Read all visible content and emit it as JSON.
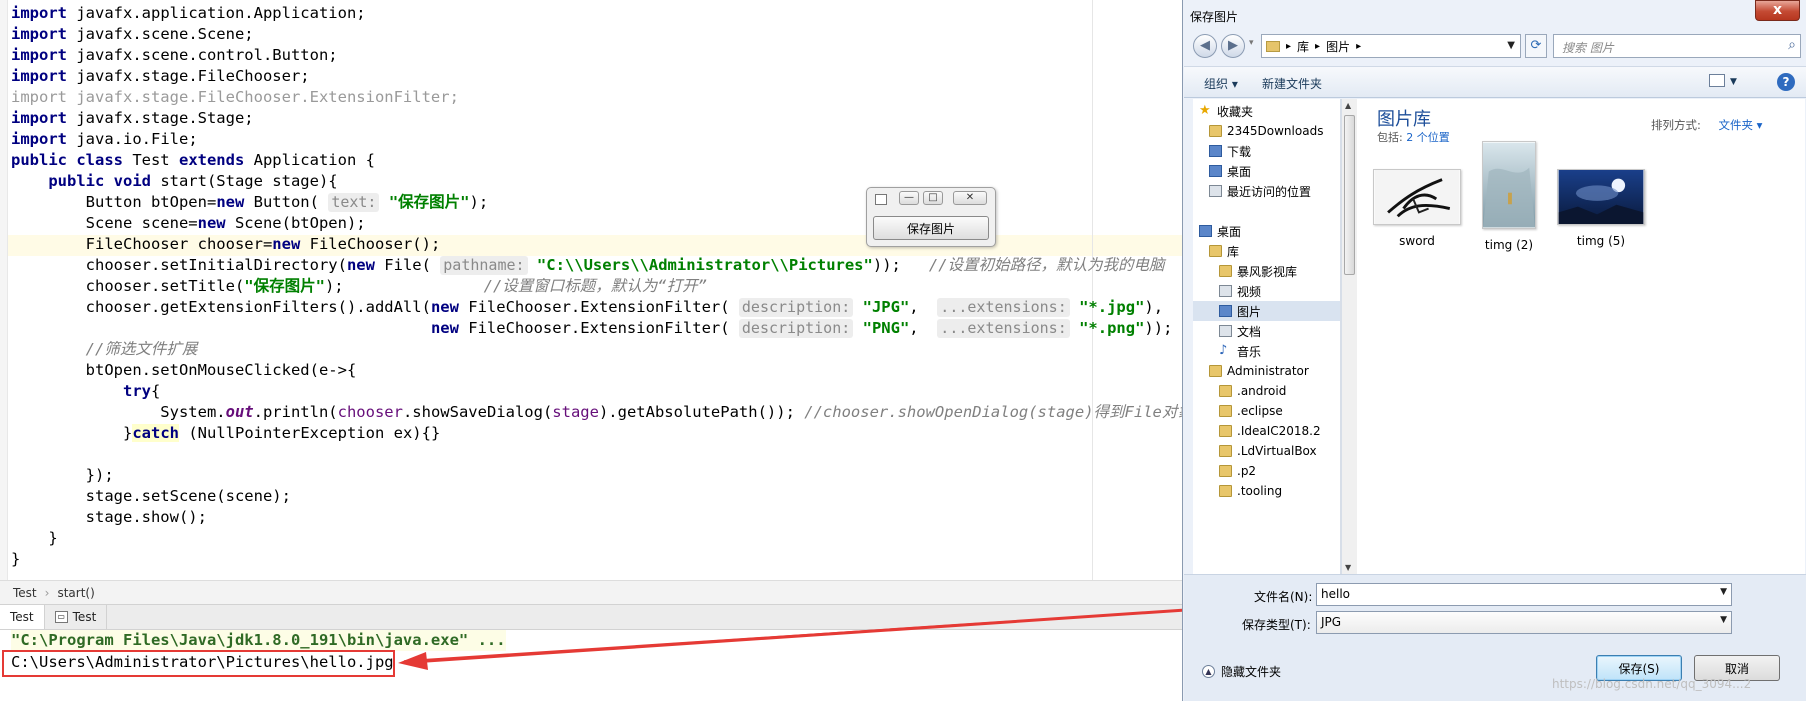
{
  "ide": {
    "code_lines": [
      [
        {
          "t": "import",
          "c": "kw"
        },
        {
          "t": " javafx.application.Application;"
        }
      ],
      [
        {
          "t": "import",
          "c": "kw"
        },
        {
          "t": " javafx.scene.Scene;"
        }
      ],
      [
        {
          "t": "import",
          "c": "kw"
        },
        {
          "t": " javafx.scene.control.Button;"
        }
      ],
      [
        {
          "t": "import",
          "c": "kw"
        },
        {
          "t": " javafx.stage.FileChooser;"
        }
      ],
      [
        {
          "t": "import javafx.stage.FileChooser.ExtensionFilter;",
          "c": "grey"
        }
      ],
      [
        {
          "t": "import",
          "c": "kw"
        },
        {
          "t": " javafx.stage.Stage;"
        }
      ],
      [
        {
          "t": "import",
          "c": "kw"
        },
        {
          "t": " java.io.File;"
        }
      ],
      [
        {
          "t": "public class",
          "c": "kw"
        },
        {
          "t": " Test "
        },
        {
          "t": "extends",
          "c": "kw"
        },
        {
          "t": " Application {"
        }
      ],
      [
        {
          "t": "    "
        },
        {
          "t": "public void",
          "c": "kw"
        },
        {
          "t": " start(Stage stage){"
        }
      ],
      [
        {
          "t": "        Button btOpen="
        },
        {
          "t": "new",
          "c": "kw"
        },
        {
          "t": " Button( "
        },
        {
          "t": "text:",
          "c": "hint"
        },
        {
          "t": " "
        },
        {
          "t": "\"保存图片\"",
          "c": "str"
        },
        {
          "t": ");"
        }
      ],
      [
        {
          "t": "        Scene scene="
        },
        {
          "t": "new",
          "c": "kw"
        },
        {
          "t": " Scene(btOpen);"
        }
      ],
      [
        {
          "t": "        FileChooser chooser="
        },
        {
          "t": "new",
          "c": "kw"
        },
        {
          "t": " FileChooser();"
        }
      ],
      [
        {
          "t": "        chooser.setInitialDirectory("
        },
        {
          "t": "new",
          "c": "kw"
        },
        {
          "t": " File( "
        },
        {
          "t": "pathname:",
          "c": "hint"
        },
        {
          "t": " "
        },
        {
          "t": "\"C:\\\\Users\\\\Administrator\\\\Pictures\"",
          "c": "str"
        },
        {
          "t": "));   "
        },
        {
          "t": "//设置初始路径，默认为我的电脑",
          "c": "cmt"
        }
      ],
      [
        {
          "t": "        chooser.setTitle("
        },
        {
          "t": "\"保存图片\"",
          "c": "str"
        },
        {
          "t": ");               "
        },
        {
          "t": "//设置窗口标题，默认为“打开”",
          "c": "cmt"
        }
      ],
      [
        {
          "t": "        chooser.getExtensionFilters().addAll("
        },
        {
          "t": "new",
          "c": "kw"
        },
        {
          "t": " FileChooser.ExtensionFilter( "
        },
        {
          "t": "description:",
          "c": "hint"
        },
        {
          "t": " "
        },
        {
          "t": "\"JPG\"",
          "c": "str"
        },
        {
          "t": ",  "
        },
        {
          "t": "...extensions:",
          "c": "hint"
        },
        {
          "t": " "
        },
        {
          "t": "\"*.jpg\"",
          "c": "str"
        },
        {
          "t": "),"
        }
      ],
      [
        {
          "t": "                                             "
        },
        {
          "t": "new",
          "c": "kw"
        },
        {
          "t": " FileChooser.ExtensionFilter( "
        },
        {
          "t": "description:",
          "c": "hint"
        },
        {
          "t": " "
        },
        {
          "t": "\"PNG\"",
          "c": "str"
        },
        {
          "t": ",  "
        },
        {
          "t": "...extensions:",
          "c": "hint"
        },
        {
          "t": " "
        },
        {
          "t": "\"*.png\"",
          "c": "str"
        },
        {
          "t": "));"
        }
      ],
      [
        {
          "t": "        "
        },
        {
          "t": "//筛选文件扩展",
          "c": "cmt"
        }
      ],
      [
        {
          "t": "        btOpen.setOnMouseClicked(e->{"
        }
      ],
      [
        {
          "t": "            "
        },
        {
          "t": "try",
          "c": "kw"
        },
        {
          "t": "{"
        }
      ],
      [
        {
          "t": "                System."
        },
        {
          "t": "out",
          "c": "fld"
        },
        {
          "t": ".println("
        },
        {
          "t": "chooser",
          "c": "vr"
        },
        {
          "t": ".showSaveDialog("
        },
        {
          "t": "stage",
          "c": "vr"
        },
        {
          "t": ").getAbsolutePath()); "
        },
        {
          "t": "//chooser.showOpenDialog(stage)得到File对象",
          "c": "cmt"
        }
      ],
      [
        {
          "t": "            }"
        },
        {
          "t": "catch",
          "c": "kw hl"
        },
        {
          "t": " (NullPointerException ex){}"
        }
      ],
      [
        {
          "t": ""
        }
      ],
      [
        {
          "t": "        });"
        }
      ],
      [
        {
          "t": "        stage.setScene(scene);"
        }
      ],
      [
        {
          "t": "        stage.show();"
        }
      ],
      [
        {
          "t": "    }"
        }
      ],
      [
        {
          "t": "}"
        }
      ]
    ],
    "mini_window": {
      "button_label": "保存图片",
      "min": "—",
      "max": "□",
      "close": "✕"
    },
    "breadcrumb": {
      "class_name": "Test",
      "separator": "›",
      "method_name": "start()"
    },
    "tabs": [
      {
        "label": "Test",
        "active": true
      },
      {
        "label": "Test",
        "active": false
      }
    ],
    "console": {
      "command_line": "\"C:\\Program Files\\Java\\jdk1.8.0_191\\bin\\java.exe\" ...",
      "output_line": "C:\\Users\\Administrator\\Pictures\\hello.jpg"
    },
    "annotation_color": "#e53a35"
  },
  "dialog": {
    "title": "保存图片",
    "close_glyph": "x",
    "back_glyph": "◀",
    "forward_glyph": "▶",
    "address_path": [
      "库",
      "图片"
    ],
    "address_sep": "▸",
    "search_placeholder": "搜索 图片",
    "toolbar": {
      "organize": "组织 ▾",
      "new_folder": "新建文件夹",
      "help": "?"
    },
    "nav_items": [
      {
        "label": "收藏夹",
        "icon": "star-icon"
      },
      {
        "label": "2345Downloads",
        "icon": "folder-icon"
      },
      {
        "label": "下载",
        "icon": "download-folder-icon"
      },
      {
        "label": "桌面",
        "icon": "desktop-icon"
      },
      {
        "label": "最近访问的位置",
        "icon": "recent-places-icon"
      },
      {
        "label": "桌面",
        "icon": "desktop-icon"
      },
      {
        "label": "库",
        "icon": "library-icon"
      },
      {
        "label": "暴风影视库",
        "icon": "folder-icon"
      },
      {
        "label": "视频",
        "icon": "videos-icon"
      },
      {
        "label": "图片",
        "icon": "pictures-icon",
        "selected": true
      },
      {
        "label": "文档",
        "icon": "documents-icon"
      },
      {
        "label": "音乐",
        "icon": "music-icon"
      },
      {
        "label": "Administrator",
        "icon": "user-folder-icon"
      },
      {
        "label": ".android",
        "icon": "folder-icon"
      },
      {
        "label": ".eclipse",
        "icon": "folder-icon"
      },
      {
        "label": ".IdeaIC2018.2",
        "icon": "folder-icon"
      },
      {
        "label": ".LdVirtualBox",
        "icon": "folder-icon"
      },
      {
        "label": ".p2",
        "icon": "folder-icon"
      },
      {
        "label": ".tooling",
        "icon": "folder-icon"
      }
    ],
    "library": {
      "title": "图片库",
      "includes_label": "包括:",
      "includes_link": "2 个位置",
      "sort_label": "排列方式:",
      "sort_value": "文件夹 ▾"
    },
    "thumbnails": [
      {
        "name": "sword"
      },
      {
        "name": "timg (2)"
      },
      {
        "name": "timg (5)"
      }
    ],
    "filename_label": "文件名(N):",
    "filename_value": "hello",
    "filetype_label": "保存类型(T):",
    "filetype_value": "JPG",
    "hide_folders": "隐藏文件夹",
    "save_button": "保存(S)",
    "cancel_button": "取消"
  },
  "watermark": "https://blog.csdn.net/qq_3094...2"
}
